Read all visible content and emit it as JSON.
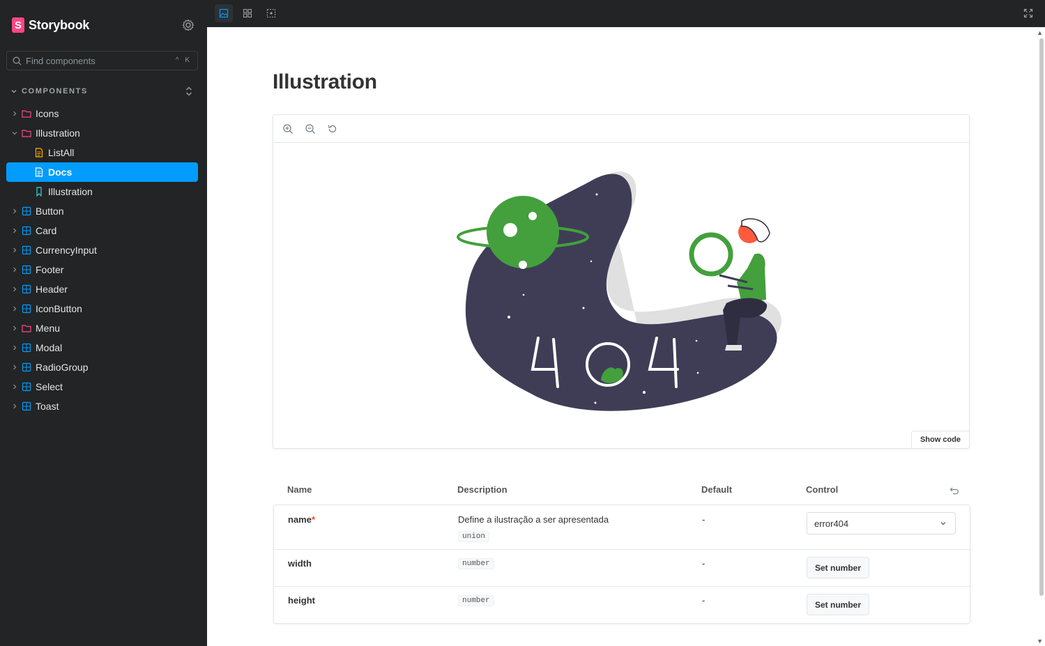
{
  "app": {
    "name": "Storybook",
    "logo_letter": "S",
    "brand_color": "#ff4785",
    "accent": "#029cfd"
  },
  "sidebar": {
    "search_placeholder": "Find components",
    "search_shortcut": "^ K",
    "section_title": "COMPONENTS",
    "items": [
      {
        "label": "Icons",
        "icon": "folder-icon"
      },
      {
        "label": "Illustration",
        "icon": "folder-icon"
      },
      {
        "label": "ListAll",
        "icon": "document-icon"
      },
      {
        "label": "Docs",
        "icon": "document-icon"
      },
      {
        "label": "Illustration",
        "icon": "bookmark-icon"
      },
      {
        "label": "Button",
        "icon": "component-icon"
      },
      {
        "label": "Card",
        "icon": "component-icon"
      },
      {
        "label": "CurrencyInput",
        "icon": "component-icon"
      },
      {
        "label": "Footer",
        "icon": "component-icon"
      },
      {
        "label": "Header",
        "icon": "component-icon"
      },
      {
        "label": "IconButton",
        "icon": "component-icon"
      },
      {
        "label": "Menu",
        "icon": "folder-icon"
      },
      {
        "label": "Modal",
        "icon": "component-icon"
      },
      {
        "label": "RadioGroup",
        "icon": "component-icon"
      },
      {
        "label": "Select",
        "icon": "component-icon"
      },
      {
        "label": "Toast",
        "icon": "component-icon"
      }
    ]
  },
  "docs": {
    "title": "Illustration",
    "show_code": "Show code",
    "illustration_text": "404",
    "args_headers": {
      "name": "Name",
      "description": "Description",
      "default": "Default",
      "control": "Control"
    },
    "args": [
      {
        "name": "name",
        "required": "*",
        "description": "Define a ilustração a ser apresentada",
        "type": "union",
        "default": "-",
        "control_value": "error404"
      },
      {
        "name": "width",
        "type": "number",
        "default": "-",
        "control_label": "Set number"
      },
      {
        "name": "height",
        "type": "number",
        "default": "-",
        "control_label": "Set number"
      }
    ]
  }
}
